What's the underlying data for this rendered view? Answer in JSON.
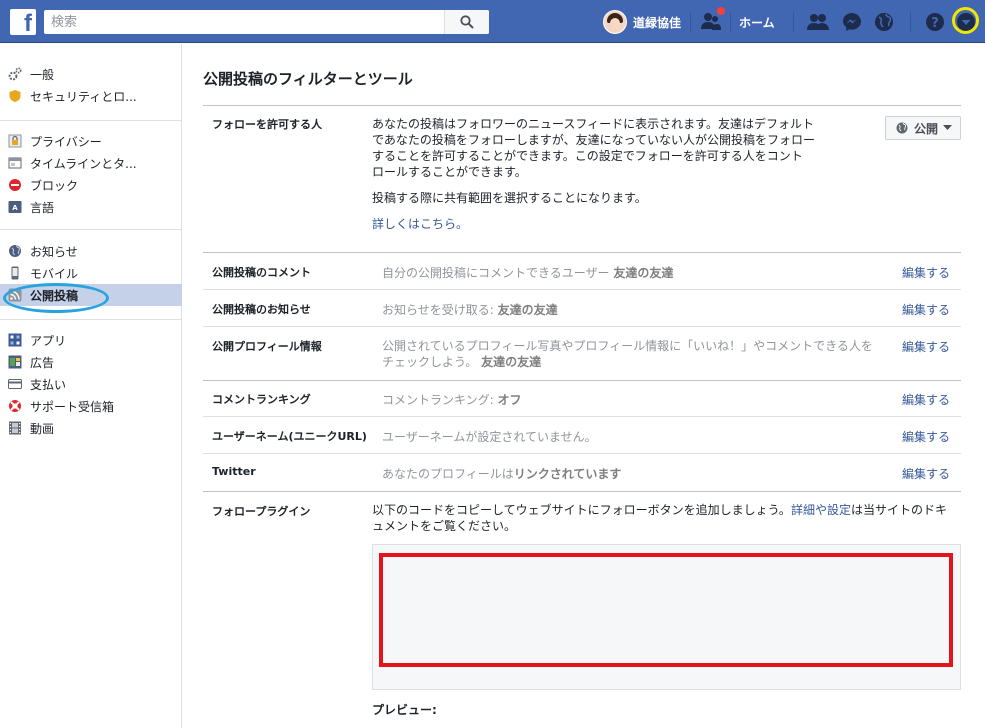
{
  "topbar": {
    "logo": "f",
    "search_placeholder": "検索",
    "profile_name": "道緑協佳",
    "home_label": "ホーム",
    "colors": {
      "bar": "#4267b2",
      "notification_dot": "#fa3e3e",
      "highlight_ring": "#f2e600"
    }
  },
  "sidebar": {
    "groups": [
      {
        "items": [
          {
            "label": "一般",
            "icon": "gear-icon"
          },
          {
            "label": "セキュリティとロ...",
            "icon": "shield-icon"
          }
        ]
      },
      {
        "items": [
          {
            "label": "プライバシー",
            "icon": "lock-icon"
          },
          {
            "label": "タイムラインとタ...",
            "icon": "timeline-icon"
          },
          {
            "label": "ブロック",
            "icon": "block-icon"
          },
          {
            "label": "言語",
            "icon": "language-icon"
          }
        ]
      },
      {
        "items": [
          {
            "label": "お知らせ",
            "icon": "globe-icon"
          },
          {
            "label": "モバイル",
            "icon": "mobile-icon"
          },
          {
            "label": "公開投稿",
            "icon": "rss-icon",
            "active": true
          }
        ]
      },
      {
        "items": [
          {
            "label": "アプリ",
            "icon": "apps-icon"
          },
          {
            "label": "広告",
            "icon": "ads-icon"
          },
          {
            "label": "支払い",
            "icon": "card-icon"
          },
          {
            "label": "サポート受信箱",
            "icon": "lifebuoy-icon"
          },
          {
            "label": "動画",
            "icon": "film-icon"
          }
        ]
      }
    ]
  },
  "main": {
    "title": "公開投稿のフィルターとツール",
    "follow": {
      "label": "フォローを許可する人",
      "lines": [
        "あなたの投稿はフォロワーのニュースフィードに表示されます。友達はデフォルト",
        "であなたの投稿をフォローしますが、友達になっていない人が公開投稿をフォロー",
        "することを許可することができます。この設定でフォローを許可する人をコント",
        "ロールすることができます。"
      ],
      "note": "投稿する際に共有範囲を選択することになります。",
      "learn_more": "詳しくはこちら。",
      "audience_button": "公開"
    },
    "rows": [
      {
        "label": "公開投稿のコメント",
        "desc": "自分の公開投稿にコメントできるユーザー",
        "value": "友達の友達",
        "edit": "編集する"
      },
      {
        "label": "公開投稿のお知らせ",
        "desc": "お知らせを受け取る:",
        "value": "友達の友達",
        "edit": "編集する"
      },
      {
        "label": "公開プロフィール情報",
        "desc": "公開されているプロフィール写真やプロフィール情報に「いいね！」やコメントできる人を",
        "desc2": "チェックしよう。",
        "value": "友達の友達",
        "edit": "編集する"
      },
      {
        "label": "コメントランキング",
        "desc": "コメントランキング:",
        "value": "オフ",
        "edit": "編集する"
      },
      {
        "label": "ユーザーネーム(ユニークURL)",
        "desc": "ユーザーネームが設定されていません。",
        "value": "",
        "edit": "編集する"
      },
      {
        "label": "Twitter",
        "desc": "あなたのプロフィールは",
        "value": "リンクされています",
        "edit": "編集する"
      }
    ],
    "plugin": {
      "label": "フォロープラグイン",
      "line1_pre": "以下のコードをコピーしてウェブサイトにフォローボタンを追加しましょう。",
      "line1_link": "詳細や設定",
      "line1_post": "は当サイトのドキ",
      "line2": "ュメントをご覧ください。",
      "preview_label": "プレビュー:"
    }
  }
}
